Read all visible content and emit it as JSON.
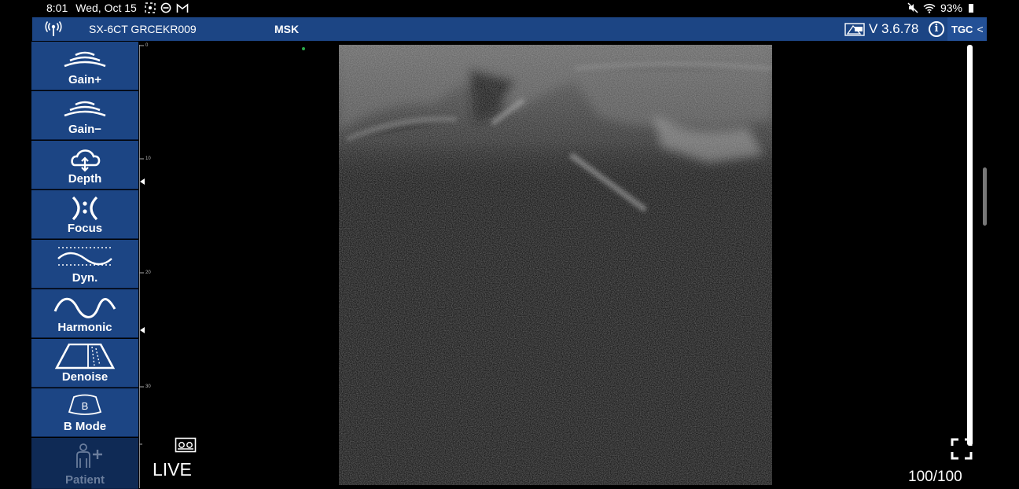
{
  "status_bar": {
    "time": "8:01",
    "date": "Wed, Oct 15",
    "battery": "93%",
    "icons": [
      "screenshot-icon",
      "dnd-icon",
      "gmail-icon",
      "mute-icon",
      "wifi-icon",
      "battery-icon"
    ]
  },
  "header": {
    "device": "SX-6CT GRCEKR009",
    "preset": "MSK",
    "version": "V 3.6.78",
    "info_glyph": "i",
    "tgc_label": "TGC",
    "tgc_chevron": "<",
    "background": "#1c4584"
  },
  "toolbar": {
    "items": [
      {
        "label": "Gain+",
        "icon": "gain-plus-icon"
      },
      {
        "label": "Gain−",
        "icon": "gain-minus-icon"
      },
      {
        "label": "Depth",
        "icon": "depth-icon"
      },
      {
        "label": "Focus",
        "icon": "focus-icon"
      },
      {
        "label": "Dyn.",
        "icon": "dynamic-range-icon"
      },
      {
        "label": "Harmonic",
        "icon": "harmonic-icon"
      },
      {
        "label": "Denoise",
        "icon": "denoise-icon"
      },
      {
        "label": "B Mode",
        "icon": "b-mode-icon",
        "icon_text": "B"
      },
      {
        "label": "Patient",
        "icon": "patient-icon"
      }
    ]
  },
  "depth_scale": {
    "labels": [
      "0",
      "10",
      "20",
      "30"
    ]
  },
  "image": {
    "mode": "LIVE",
    "frame_counter": "100/100"
  }
}
